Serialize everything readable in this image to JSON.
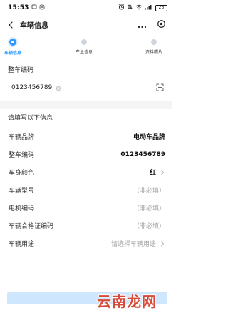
{
  "status_bar": {
    "time": "15:53",
    "battery": "26"
  },
  "header": {
    "title": "车辆信息"
  },
  "steps": [
    {
      "label": "车辆信息",
      "active": true
    },
    {
      "label": "车主信息",
      "active": false
    },
    {
      "label": "资料照片",
      "active": false
    }
  ],
  "vin_section": {
    "title": "整车编码",
    "value": "0123456789"
  },
  "form": {
    "title": "请填写以下信息",
    "rows": [
      {
        "label": "车辆品牌",
        "value": "电动车品牌",
        "arrow": false
      },
      {
        "label": "整车编码",
        "value": "0123456789",
        "arrow": false
      },
      {
        "label": "车身颜色",
        "value": "红",
        "arrow": true
      },
      {
        "label": "车辆型号",
        "value": "（非必填）",
        "arrow": false
      },
      {
        "label": "电机编码",
        "value": "（非必填）",
        "arrow": false
      },
      {
        "label": "车辆合格证编码",
        "value": "（非必填）",
        "arrow": false
      },
      {
        "label": "车辆用途",
        "value": "请选择车辆用途",
        "arrow": true
      }
    ]
  },
  "footer": {
    "watermark": "云南龙网"
  },
  "colors": {
    "primary": "#2f97ff",
    "button_background": "#cfe6ff",
    "watermark": "#d74b3b"
  },
  "icons": {
    "back": "back-icon",
    "more": "more-icon",
    "target": "target-icon",
    "scan": "scan-icon",
    "clear": "clear-icon",
    "chevron": "chevron-right-icon"
  }
}
